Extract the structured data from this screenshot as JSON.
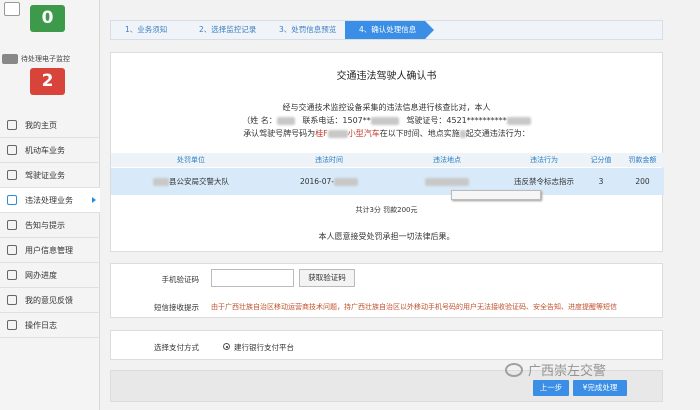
{
  "sidebar": {
    "top_count": "0",
    "pending_label": "待处理电子监控",
    "pending_count": "2",
    "items": [
      {
        "label": "我的主页"
      },
      {
        "label": "机动车业务"
      },
      {
        "label": "驾驶证业务"
      },
      {
        "label": "违法处理业务"
      },
      {
        "label": "告知与提示"
      },
      {
        "label": "用户信息管理"
      },
      {
        "label": "网办进度"
      },
      {
        "label": "我的意见反馈"
      },
      {
        "label": "操作日志"
      }
    ],
    "active_index": 3
  },
  "steps": [
    "1、业务须知",
    "2、选择监控记录",
    "3、处罚信息预览",
    "4、确认处理信息"
  ],
  "confirm": {
    "title": "交通违法驾驶人确认书",
    "line1": "经与交通技术监控设备采集的违法信息进行核查比对，本人",
    "name_label": "（姓 名：",
    "phone_label": "联系电话：1507**",
    "license_label": "驾驶证号：4521**********",
    "line3_a": "承认驾驶号牌号码为",
    "line3_plate": "桂F",
    "line3_vehicle": "小型汽车",
    "line3_b": "在以下时间、地点实施",
    "line3_c": "起交通违法行为："
  },
  "table": {
    "headers": [
      "处罚单位",
      "违法时间",
      "违法地点",
      "违法行为",
      "记分值",
      "罚款金额"
    ],
    "row": {
      "unit": "县公安局交警大队",
      "time": "2016-07-",
      "place": "",
      "action": "违反禁令标志指示",
      "points": "3",
      "fine": "200"
    }
  },
  "summary": "共计3分  罚款200元",
  "declaration": "本人愿意接受处罚承担一切法律后果。",
  "sms": {
    "phone_label": "手机验证码",
    "phone_value": "",
    "get_code": "获取验证码",
    "tip_label": "短信接收提示",
    "tip_text": "由于广西壮族自治区移动运营商技术问题，持广西壮族自治区以外移动手机号码的用户无法接收验证码、安全告知、进度提醒等短信"
  },
  "payment": {
    "label": "选择支付方式",
    "option": "建行银行支付平台"
  },
  "buttons": {
    "prev": "上一步",
    "finish": "¥完成处理"
  },
  "watermark": "广西崇左交警",
  "colors": {
    "accent": "#3a8ee6",
    "green_badge": "#3d9a4a",
    "red_badge": "#d9443a",
    "warning_text": "#c0502b"
  }
}
